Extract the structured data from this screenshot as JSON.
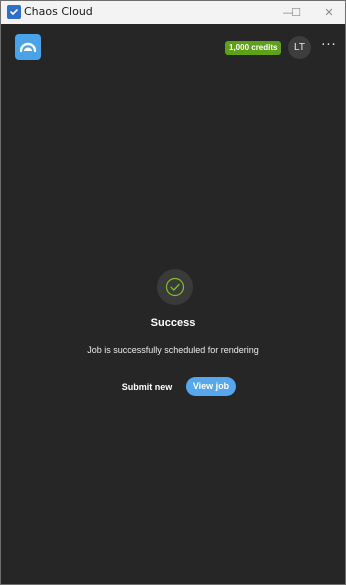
{
  "window": {
    "title": "Chaos Cloud",
    "controls": {
      "minimize": "—",
      "maximize": "☐",
      "close": "✕"
    }
  },
  "header": {
    "credits": "1,000 credits",
    "avatar_initials": "LT",
    "more_icon": "more-horizontal-icon",
    "more_glyph": "···"
  },
  "main": {
    "status_icon": "check-circle-icon",
    "title": "Success",
    "message": "Job is successfully scheduled for rendering",
    "submit_new_label": "Submit new",
    "view_job_label": "View job"
  },
  "colors": {
    "background": "#262626",
    "credits_badge": "#5fa019",
    "primary_button": "#55a7ee",
    "check_accent": "#7fbf2a"
  }
}
